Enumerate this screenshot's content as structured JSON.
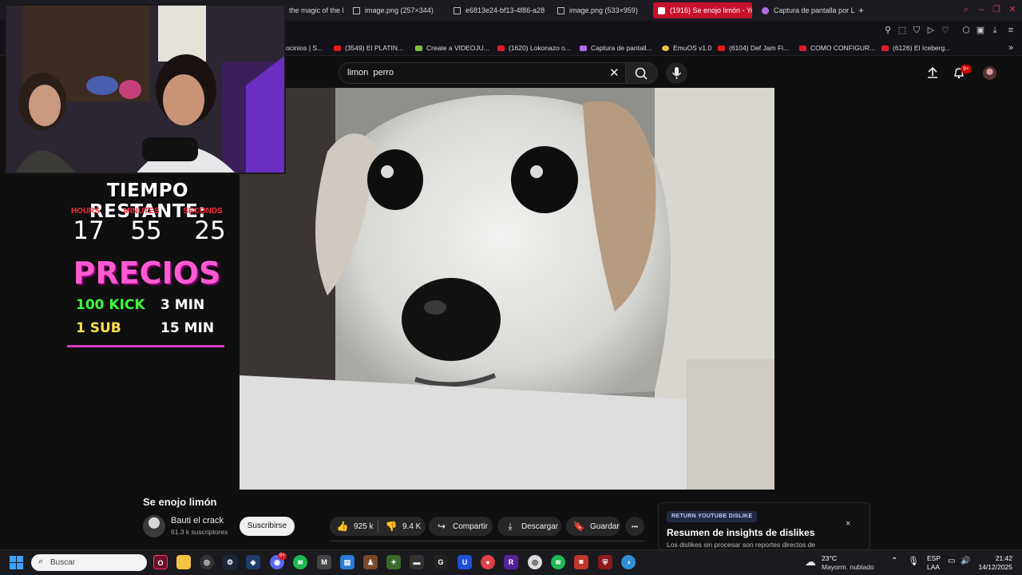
{
  "browser": {
    "tabs": [
      {
        "label": "the magic of the l",
        "active": false
      },
      {
        "label": "image.png (257×344)",
        "active": false
      },
      {
        "label": "e6813e24-bf13-4f86-a28",
        "active": false
      },
      {
        "label": "image.png (533×959)",
        "active": false
      },
      {
        "label": "(1916) Se enojo limón - Yo",
        "active": true
      },
      {
        "label": "Captura de pantalla por L",
        "active": false
      }
    ],
    "new_tab_label": "+",
    "bookmarks": [
      "ocinios | S...",
      "(3549) El PLATIN...",
      "Create a VIDEOJU...",
      "(1620) Lokonazo o...",
      "Captura de pantall...",
      "EmuOS v1.0",
      "(6104) Def Jam Fi...",
      "COMO CONFIGUR...",
      "(6126) El Iceberg..."
    ]
  },
  "youtube": {
    "search_value": "limon  perro",
    "notification_count": "9+"
  },
  "overlay": {
    "timer_title": "TIEMPO RESTANTE:",
    "labels": {
      "hours": "HOURS",
      "minutes": "MINUTES",
      "seconds": "SECONDS"
    },
    "values": {
      "hours": "17",
      "minutes": "55",
      "seconds": "25"
    },
    "precios_title": "PRECIOS",
    "prices": [
      {
        "left": "100 KICK",
        "right": "3 MIN",
        "left_color": "#3cff3c"
      },
      {
        "left": "1 SUB",
        "right": "15 MIN",
        "left_color": "#ffe14a"
      }
    ]
  },
  "video": {
    "title": "Se enojo limón",
    "channel_name": "Bauti el crack",
    "channel_subs": "61.3 k suscriptores",
    "subscribe_label": "Suscribirse",
    "likes": "925 k",
    "dislikes": "9.4 K",
    "share_label": "Compartir",
    "download_label": "Descargar",
    "save_label": "Guardar",
    "more_label": "•••"
  },
  "dislike_panel": {
    "badge": "RETURN YOUTUBE DISLIKE",
    "title": "Resumen de insights de dislikes",
    "text": "Los dislikes sin procesar son reportes directos de",
    "close": "×"
  },
  "taskbar": {
    "search_placeholder": "Buscar",
    "weather_temp": "23°C",
    "weather_desc": "Mayorm. nublado",
    "lang1": "ESP",
    "lang2": "LAA",
    "time": "21:42",
    "date": "14/12/2025",
    "discord_badge": "9+"
  },
  "colors": {
    "brand_red": "#c7112b",
    "overlay_pink": "#ff5ad1",
    "timer_red": "#ff2a3a"
  }
}
